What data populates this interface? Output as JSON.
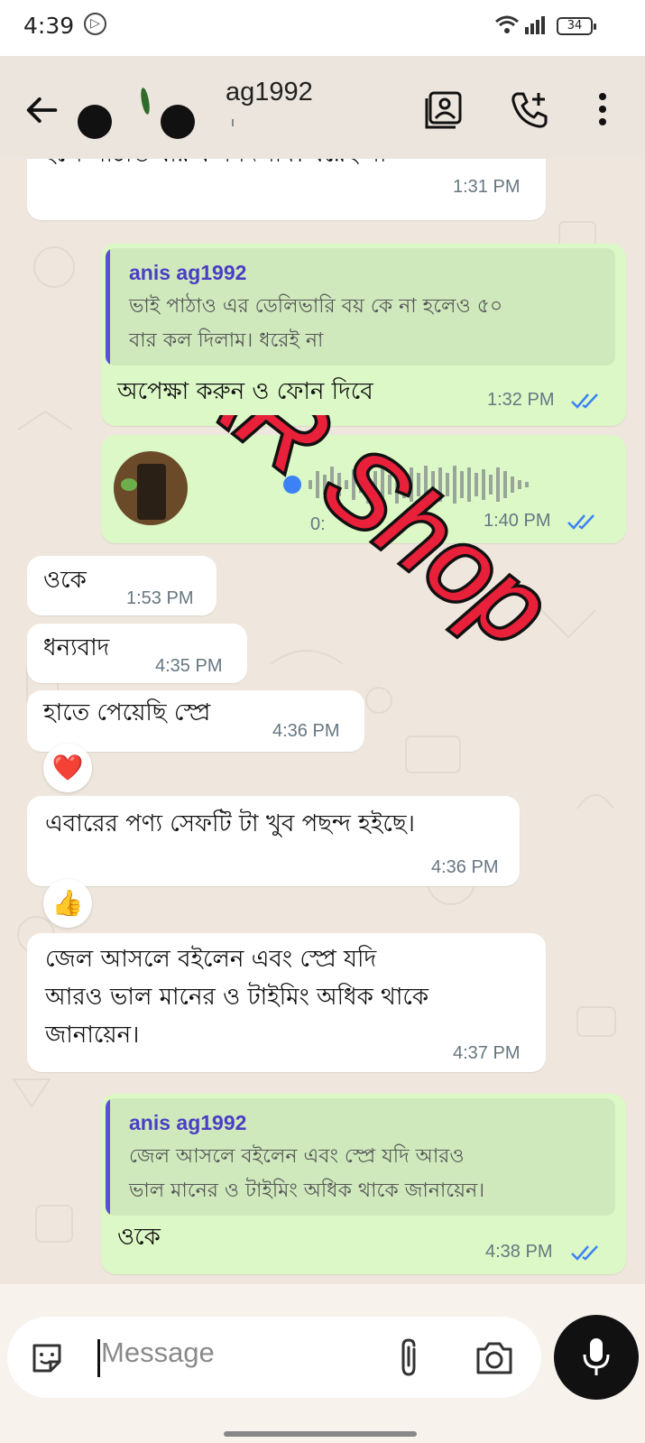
{
  "status_bar": {
    "time": "4:39",
    "battery": "34"
  },
  "header": {
    "contact_name": "ag1992"
  },
  "messages": [
    {
      "text": "হলে    পাঠাও    বার কল দিলাম। ধরেই না",
      "time": "1:31 PM"
    },
    {
      "quote_name": "anis ag1992",
      "quote_line1": "ভাই পাঠাও এর ডেলিভারি বয় কে না হলেও ৫০",
      "quote_line2": "বার কল দিলাম। ধরেই না",
      "text": "অপেক্ষা করুন ও ফোন দিবে",
      "time": "1:32 PM"
    },
    {
      "voice_duration": "0:",
      "time": "1:40 PM"
    },
    {
      "text": "ওকে",
      "time": "1:53 PM"
    },
    {
      "text": "ধন্যবাদ",
      "time": "4:35 PM"
    },
    {
      "text": "হাতে পেয়েছি স্প্রে",
      "time": "4:36 PM",
      "reaction": "❤️"
    },
    {
      "text": "এবারের পণ্য সেফটি টা খুব পছন্দ হইছে।",
      "time": "4:36 PM",
      "reaction": "👍"
    },
    {
      "line1": "জেল আসলে বইলেন এবং স্প্রে যদি",
      "line2": "আরও ভাল মানের ও টাইমিং অধিক থাকে",
      "line3": "জানায়েন।",
      "time": "4:37 PM"
    },
    {
      "quote_name": "anis ag1992",
      "quote_line1": "জেল আসলে বইলেন এবং স্প্রে যদি আরও",
      "quote_line2": "ভাল মানের ও টাইমিং অধিক থাকে জানায়েন।",
      "text": "ওকে",
      "time": "4:38 PM"
    }
  ],
  "watermark": "AR Shop",
  "composer": {
    "placeholder": "Message"
  },
  "colors": {
    "outgoing": "#dcf8c6",
    "incoming": "#ffffff",
    "read_ticks": "#3b82f6",
    "watermark_fill": "#e8203a"
  },
  "icons": [
    "back-arrow-icon",
    "contact-card-icon",
    "add-call-icon",
    "more-options-icon",
    "sticker-icon",
    "attach-icon",
    "camera-icon",
    "mic-icon"
  ]
}
